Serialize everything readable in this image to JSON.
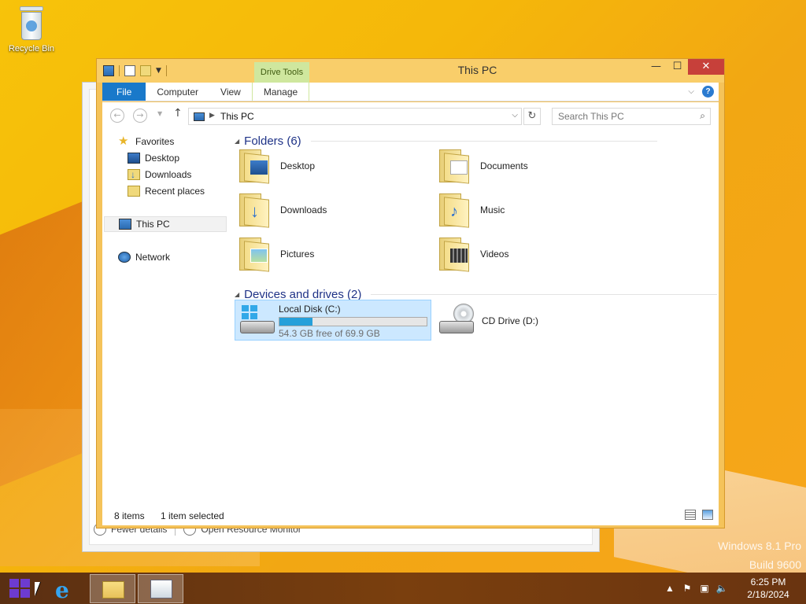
{
  "desktop": {
    "recycle_bin_label": "Recycle Bin",
    "watermark_line1": "Windows 8.1 Pro",
    "watermark_line2": "Build 9600"
  },
  "back_window": {
    "fewer_details": "Fewer details",
    "open_resource_monitor": "Open Resource Monitor"
  },
  "window": {
    "title": "This PC",
    "contextual_tab_group": "Drive Tools",
    "close_glyph": "✕",
    "minimize_glyph": "—",
    "maximize_glyph": "☐"
  },
  "ribbon": {
    "tabs": [
      {
        "label": "File"
      },
      {
        "label": "Computer"
      },
      {
        "label": "View"
      },
      {
        "label": "Manage"
      }
    ],
    "help_glyph": "?"
  },
  "address": {
    "path": "This PC",
    "search_placeholder": "Search This PC"
  },
  "sidebar": {
    "favorites": "Favorites",
    "items": [
      {
        "label": "Desktop"
      },
      {
        "label": "Downloads"
      },
      {
        "label": "Recent places"
      }
    ],
    "this_pc": "This PC",
    "network": "Network"
  },
  "folders": {
    "header": "Folders (6)",
    "items": [
      {
        "label": "Desktop",
        "icon": "desktop-folder-icon"
      },
      {
        "label": "Documents",
        "icon": "documents-folder-icon"
      },
      {
        "label": "Downloads",
        "icon": "downloads-folder-icon"
      },
      {
        "label": "Music",
        "icon": "music-folder-icon"
      },
      {
        "label": "Pictures",
        "icon": "pictures-folder-icon"
      },
      {
        "label": "Videos",
        "icon": "videos-folder-icon"
      }
    ]
  },
  "drives": {
    "header": "Devices and drives (2)",
    "local": {
      "label": "Local Disk (C:)",
      "free_text": "54.3 GB free of 69.9 GB",
      "used_fraction": 0.223
    },
    "cd": {
      "label": "CD Drive (D:)"
    }
  },
  "status": {
    "items_count": "8 items",
    "selected": "1 item selected"
  },
  "taskbar": {
    "time": "6:25 PM",
    "date": "2/18/2024"
  },
  "colors": {
    "accent_blue": "#1979ca",
    "drive_tools_green": "#cfe79e",
    "progress": "#26a0da",
    "close_red": "#c7403a"
  }
}
